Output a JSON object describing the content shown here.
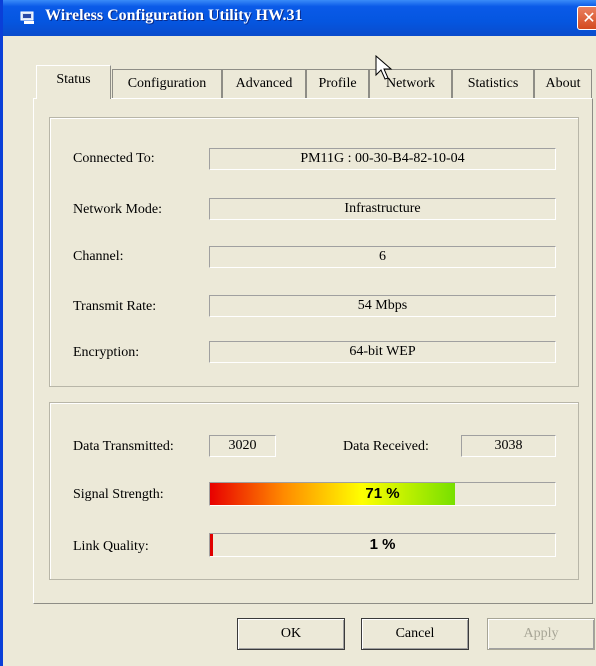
{
  "window": {
    "title": "Wireless Configuration Utility HW.31",
    "close_glyph": "✕",
    "icon": "network-computer-icon"
  },
  "tabs": [
    {
      "label": "Status",
      "active": true
    },
    {
      "label": "Configuration",
      "active": false
    },
    {
      "label": "Advanced",
      "active": false
    },
    {
      "label": "Profile",
      "active": false
    },
    {
      "label": "Network",
      "active": false
    },
    {
      "label": "Statistics",
      "active": false
    },
    {
      "label": "About",
      "active": false
    }
  ],
  "connection": {
    "connected_to": {
      "label": "Connected To:",
      "value": "PM11G : 00-30-B4-82-10-04"
    },
    "network_mode": {
      "label": "Network Mode:",
      "value": "Infrastructure"
    },
    "channel": {
      "label": "Channel:",
      "value": "6"
    },
    "transmit_rate": {
      "label": "Transmit Rate:",
      "value": "54 Mbps"
    },
    "encryption": {
      "label": "Encryption:",
      "value": "64-bit WEP"
    }
  },
  "stats": {
    "data_transmitted": {
      "label": "Data Transmitted:",
      "value": "3020"
    },
    "data_received": {
      "label": "Data Received:",
      "value": "3038"
    },
    "signal_strength": {
      "label": "Signal Strength:",
      "value": "71 %",
      "fraction": 0.71
    },
    "link_quality": {
      "label": "Link Quality:",
      "value": "1 %",
      "fraction": 0.01
    }
  },
  "buttons": {
    "ok": "OK",
    "cancel": "Cancel",
    "apply": "Apply"
  },
  "colors": {
    "titlebar": "#0556e0",
    "signal_gradient_start": "#e80000",
    "signal_gradient_mid": "#ffff00",
    "signal_gradient_end": "#77e000",
    "link_quality_fill": "#e00000"
  }
}
